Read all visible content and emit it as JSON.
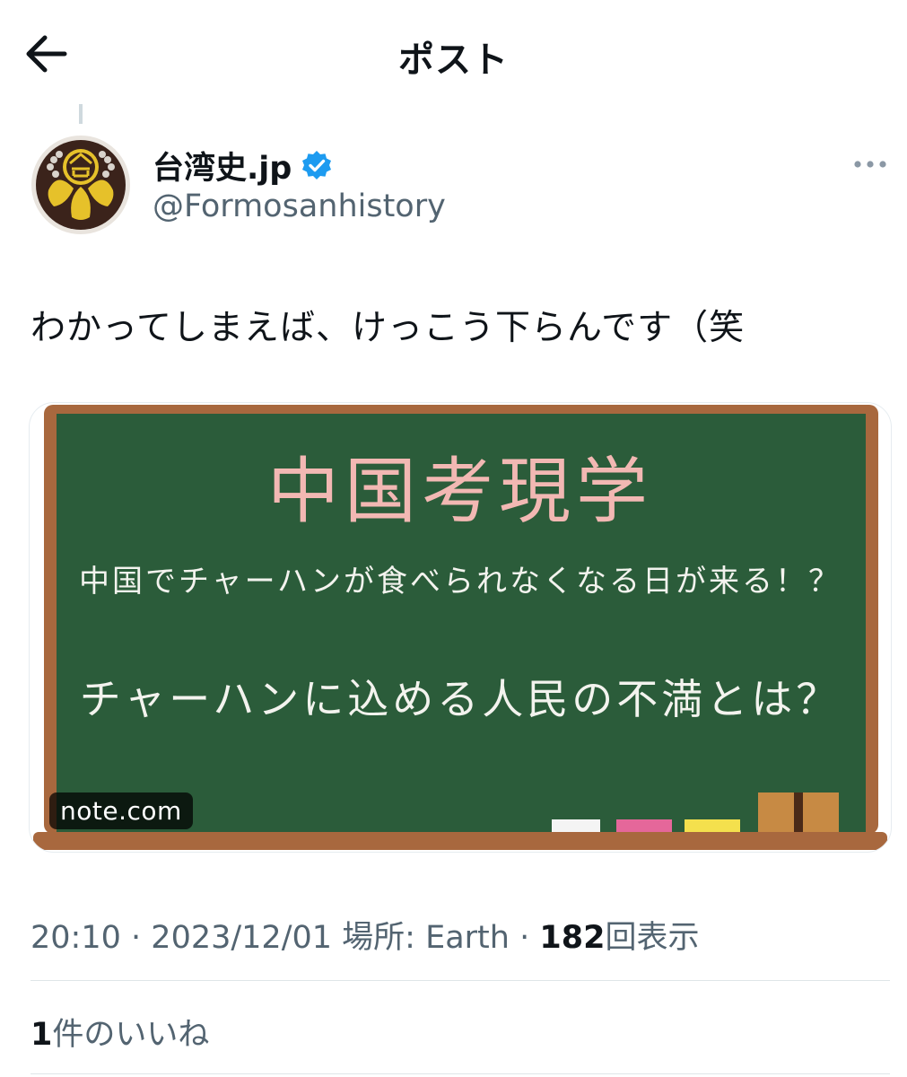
{
  "header": {
    "title": "ポスト"
  },
  "author": {
    "display_name": "台湾史.jp",
    "handle": "@Formosanhistory",
    "verified": true
  },
  "tweet": {
    "text": "わかってしまえば、けっこう下らんです（笑"
  },
  "card": {
    "title": "中国考現学",
    "subtitle": "中国でチャーハンが食べられなくなる日が来る！？",
    "question": "チャーハンに込める人民の不満とは？",
    "domain": "note.com"
  },
  "meta": {
    "time": "20:10",
    "date": "2023/12/01",
    "location_label": "場所: Earth",
    "views_count": "182",
    "views_label": "回表示",
    "separator": "·"
  },
  "likes": {
    "count": "1",
    "label": "件のいいね"
  },
  "colors": {
    "text": "#0f1419",
    "secondary": "#536471",
    "verified": "#1d9bf0",
    "chalkboard": "#2b5c3a",
    "board_frame": "#a8683e",
    "chalk_pink": "#f2b8b3"
  },
  "icons": [
    "back-arrow-icon",
    "verified-badge-icon",
    "more-options-icon"
  ]
}
